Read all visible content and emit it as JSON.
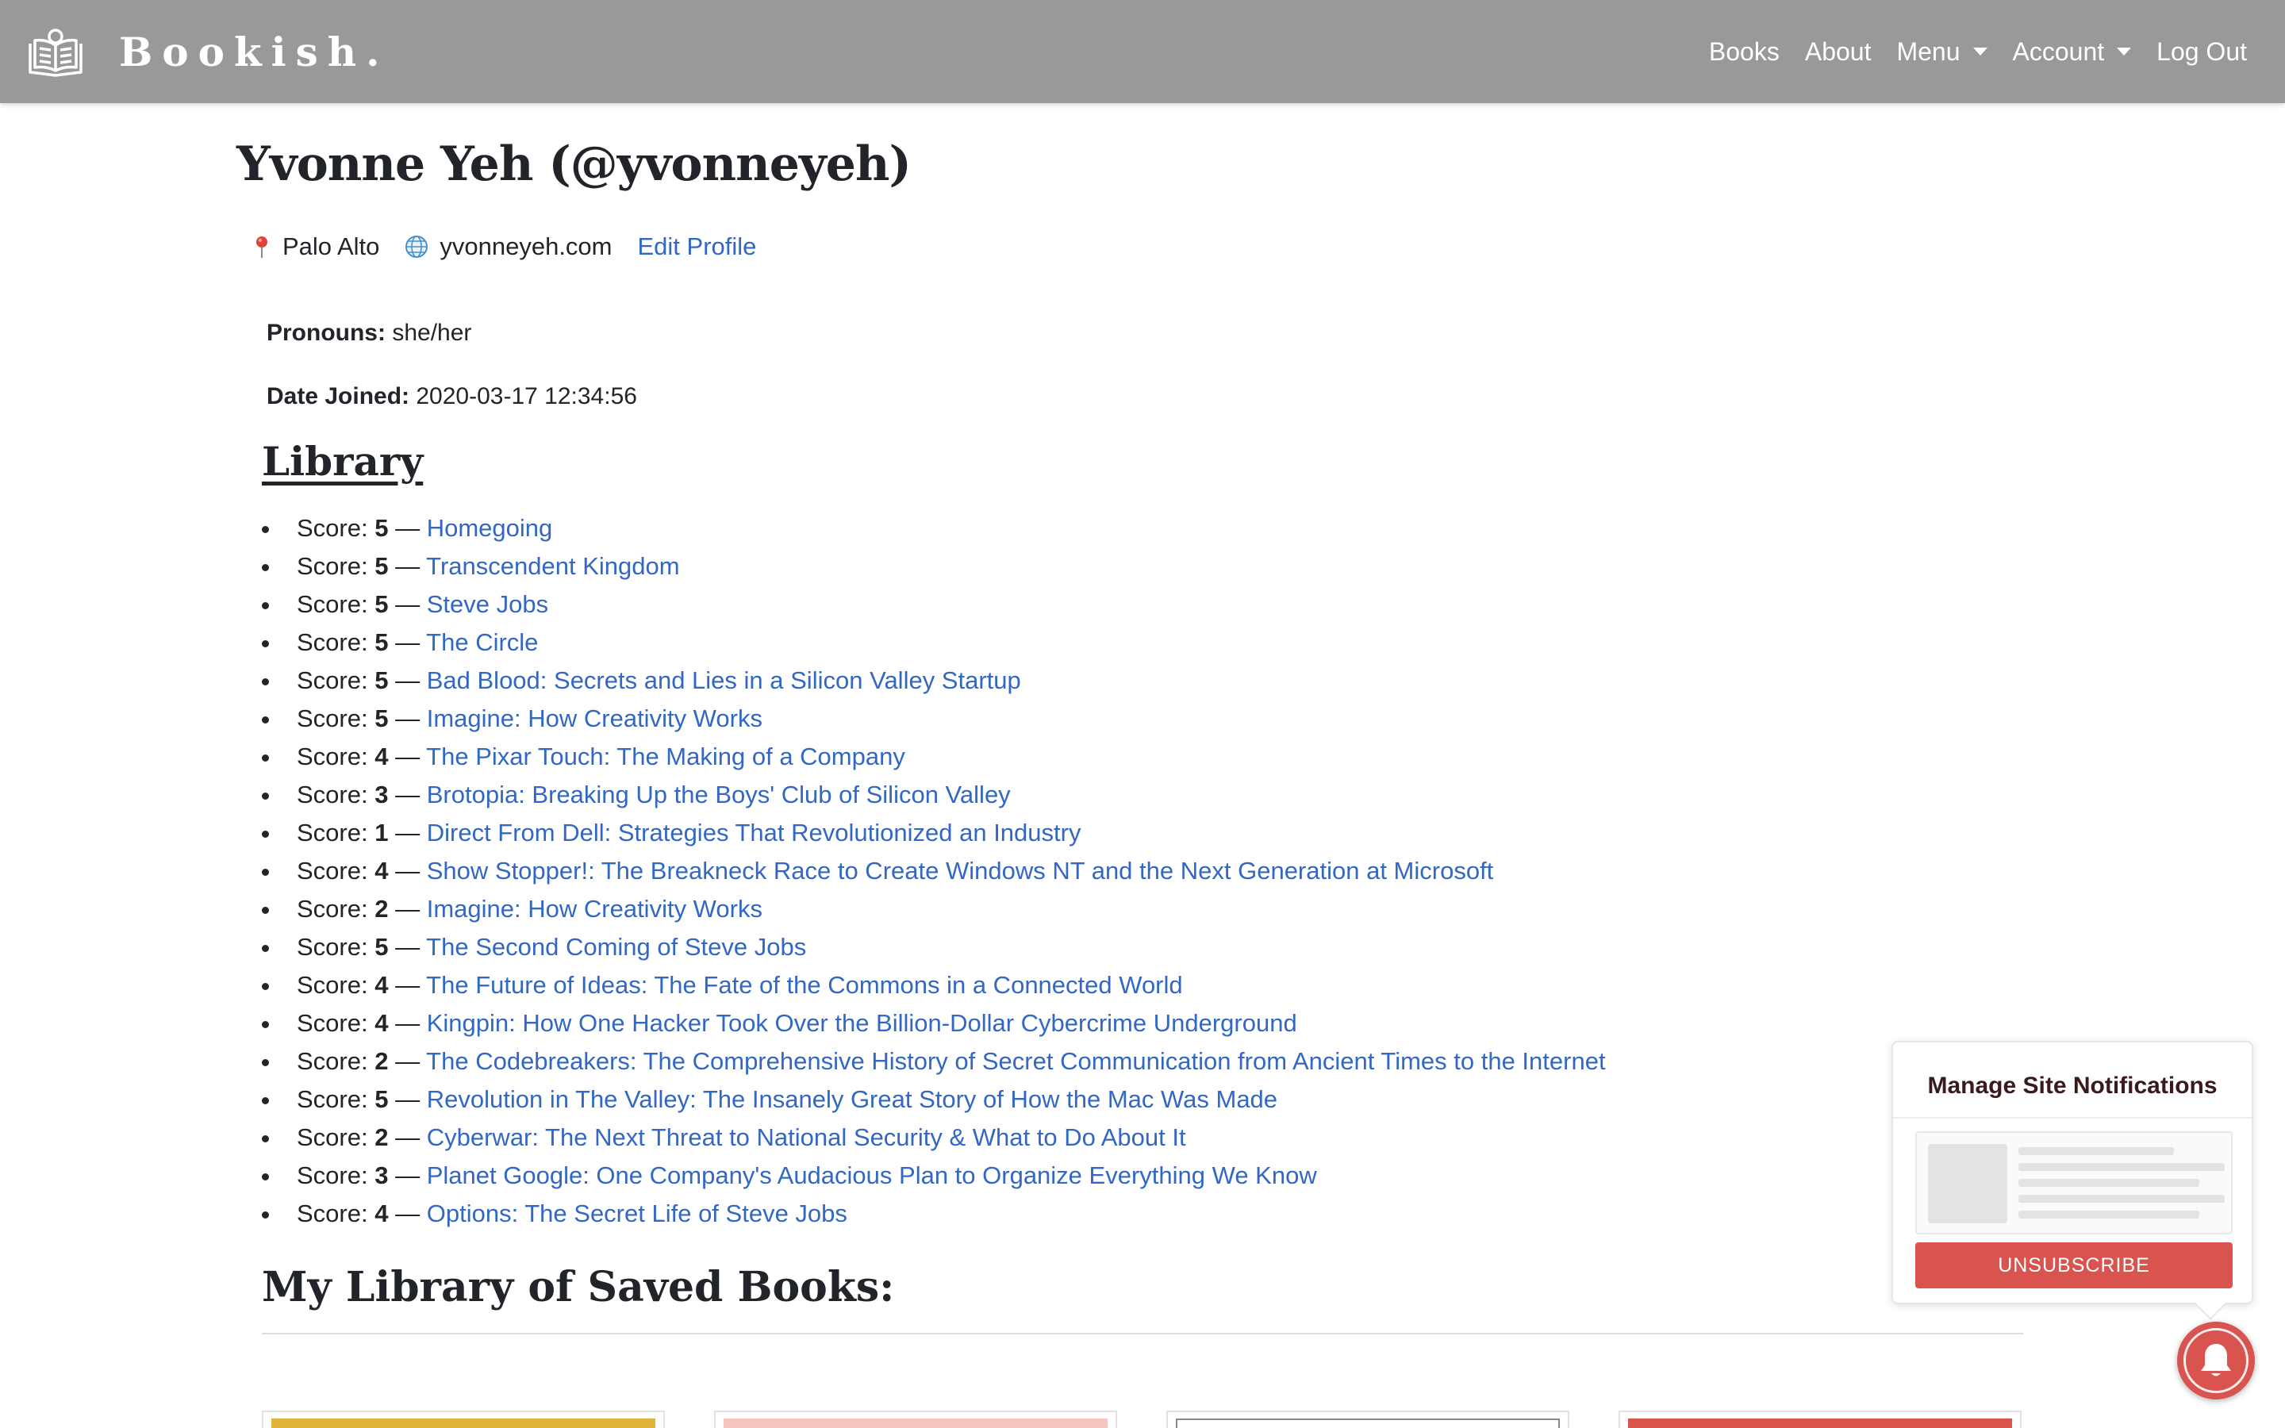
{
  "navbar": {
    "brand": "Bookish.",
    "brand_icon": "book-reader-icon",
    "items": [
      {
        "label": "Books"
      },
      {
        "label": "About"
      },
      {
        "label": "Menu"
      },
      {
        "label": "Account"
      },
      {
        "label": "Log Out"
      }
    ]
  },
  "profile": {
    "name": "Yvonne Yeh (@yvonneyeh)",
    "location": "Palo Alto",
    "website": "yvonneyeh.com",
    "edit_link": "Edit Profile",
    "pronouns_label": "Pronouns:",
    "pronouns": "she/her",
    "date_joined_label": "Date Joined:",
    "date_joined": "2020-03-17 12:34:56"
  },
  "library": {
    "heading": "Library",
    "score_label": "Score:",
    "separator": "—",
    "items": [
      {
        "score": "5",
        "title": "Homegoing"
      },
      {
        "score": "5",
        "title": "Transcendent Kingdom"
      },
      {
        "score": "5",
        "title": "Steve Jobs"
      },
      {
        "score": "5",
        "title": "The Circle"
      },
      {
        "score": "5",
        "title": "Bad Blood: Secrets and Lies in a Silicon Valley Startup"
      },
      {
        "score": "5",
        "title": "Imagine: How Creativity Works"
      },
      {
        "score": "4",
        "title": "The Pixar Touch: The Making of a Company"
      },
      {
        "score": "3",
        "title": "Brotopia: Breaking Up the Boys' Club of Silicon Valley"
      },
      {
        "score": "1",
        "title": "Direct From Dell: Strategies That Revolutionized an Industry"
      },
      {
        "score": "4",
        "title": "Show Stopper!: The Breakneck Race to Create Windows NT and the Next Generation at Microsoft"
      },
      {
        "score": "2",
        "title": "Imagine: How Creativity Works"
      },
      {
        "score": "5",
        "title": "The Second Coming of Steve Jobs"
      },
      {
        "score": "4",
        "title": "The Future of Ideas: The Fate of the Commons in a Connected World"
      },
      {
        "score": "4",
        "title": "Kingpin: How One Hacker Took Over the Billion-Dollar Cybercrime Underground"
      },
      {
        "score": "2",
        "title": "The Codebreakers: The Comprehensive History of Secret Communication from Ancient Times to the Internet"
      },
      {
        "score": "5",
        "title": "Revolution in The Valley: The Insanely Great Story of How the Mac Was Made"
      },
      {
        "score": "2",
        "title": "Cyberwar: The Next Threat to National Security & What to Do About It"
      },
      {
        "score": "3",
        "title": "Planet Google: One Company's Audacious Plan to Organize Everything We Know"
      },
      {
        "score": "4",
        "title": "Options: The Secret Life of Steve Jobs"
      }
    ]
  },
  "saved": {
    "heading": "My Library of Saved Books:"
  },
  "notifications": {
    "title": "Manage Site Notifications",
    "unsubscribe": "UNSUBSCRIBE",
    "bell_icon": "bell-icon"
  },
  "colors": {
    "navbar_bg": "#999999",
    "link": "#3367c4",
    "unsubscribe_bg": "#d9534f"
  }
}
